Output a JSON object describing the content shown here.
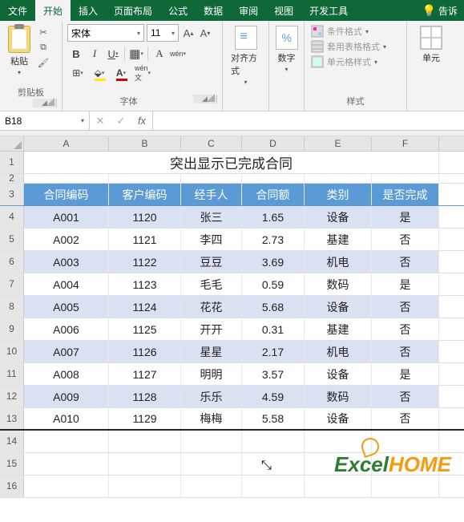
{
  "tabs": {
    "file": "文件",
    "home": "开始",
    "insert": "插入",
    "layout": "页面布局",
    "formula": "公式",
    "data": "数据",
    "review": "审阅",
    "view": "视图",
    "dev": "开发工具",
    "tell": "告诉"
  },
  "ribbon": {
    "paste": "粘贴",
    "clipboard": "剪贴板",
    "font_name": "宋体",
    "font_size": "11",
    "font": "字体",
    "align": "对齐方式",
    "number": "数字",
    "cond_fmt": "条件格式",
    "table_fmt": "套用表格格式",
    "cell_fmt": "单元格样式",
    "styles": "样式",
    "cells": "单元"
  },
  "namebox": "B18",
  "fx": "fx",
  "cols": [
    "A",
    "B",
    "C",
    "D",
    "E",
    "F"
  ],
  "title": "突出显示已完成合同",
  "headers": [
    "合同编码",
    "客户编码",
    "经手人",
    "合同额",
    "类别",
    "是否完成"
  ],
  "rows": [
    {
      "r": 4,
      "d": [
        "A001",
        "1120",
        "张三",
        "1.65",
        "设备",
        "是"
      ],
      "shade": true
    },
    {
      "r": 5,
      "d": [
        "A002",
        "1121",
        "李四",
        "2.73",
        "基建",
        "否"
      ],
      "shade": false
    },
    {
      "r": 6,
      "d": [
        "A003",
        "1122",
        "豆豆",
        "3.69",
        "机电",
        "否"
      ],
      "shade": true
    },
    {
      "r": 7,
      "d": [
        "A004",
        "1123",
        "毛毛",
        "0.59",
        "数码",
        "是"
      ],
      "shade": false
    },
    {
      "r": 8,
      "d": [
        "A005",
        "1124",
        "花花",
        "5.68",
        "设备",
        "否"
      ],
      "shade": true
    },
    {
      "r": 9,
      "d": [
        "A006",
        "1125",
        "开开",
        "0.31",
        "基建",
        "否"
      ],
      "shade": false
    },
    {
      "r": 10,
      "d": [
        "A007",
        "1126",
        "星星",
        "2.17",
        "机电",
        "否"
      ],
      "shade": true
    },
    {
      "r": 11,
      "d": [
        "A008",
        "1127",
        "明明",
        "3.57",
        "设备",
        "是"
      ],
      "shade": false
    },
    {
      "r": 12,
      "d": [
        "A009",
        "1128",
        "乐乐",
        "4.59",
        "数码",
        "否"
      ],
      "shade": true
    },
    {
      "r": 13,
      "d": [
        "A010",
        "1129",
        "梅梅",
        "5.58",
        "设备",
        "否"
      ],
      "shade": false
    }
  ],
  "empty_rows": [
    14,
    15,
    16
  ],
  "watermark": {
    "a": "E",
    "b": "xcel",
    "c": "HOME"
  }
}
